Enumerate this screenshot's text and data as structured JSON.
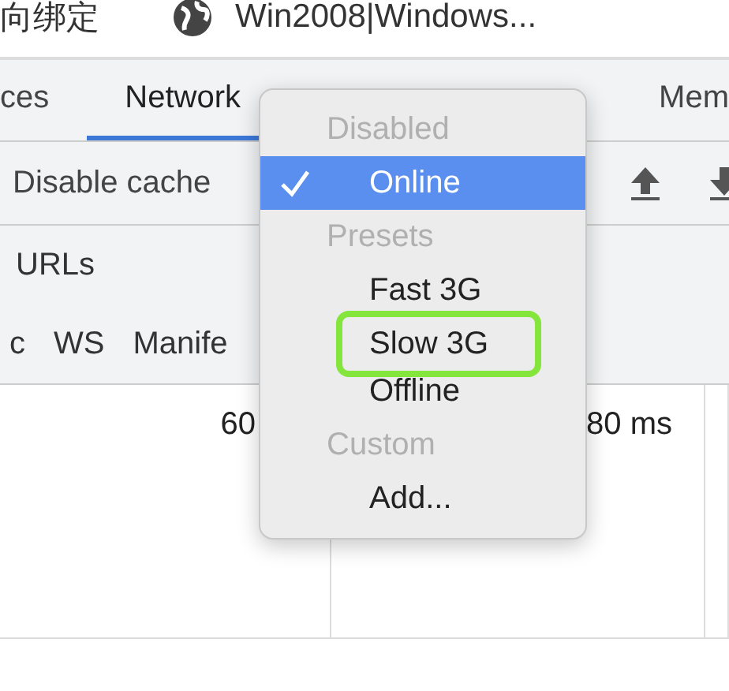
{
  "browser_tabs": [
    {
      "title": "向绑定",
      "icon": false
    },
    {
      "title": "Win2008|Windows...",
      "icon": true
    }
  ],
  "devtools_tabs": [
    {
      "label": "ces",
      "selected": false
    },
    {
      "label": "Network",
      "selected": true
    },
    {
      "label": "Mem",
      "selected": false
    }
  ],
  "toolbar": {
    "disable_cache": "Disable cache"
  },
  "filter": {
    "data_urls": "URLs",
    "types": [
      "c",
      "WS",
      "Manife"
    ]
  },
  "table": {
    "row": {
      "column_1": "60",
      "column_2": "80 ms"
    }
  },
  "throttle_menu": [
    {
      "kind": "header",
      "label": "Disabled"
    },
    {
      "kind": "option",
      "label": "Online",
      "selected": true,
      "highlighted": false
    },
    {
      "kind": "header",
      "label": "Presets"
    },
    {
      "kind": "option",
      "label": "Fast 3G",
      "selected": false,
      "highlighted": false
    },
    {
      "kind": "option",
      "label": "Slow 3G",
      "selected": false,
      "highlighted": true
    },
    {
      "kind": "option",
      "label": "Offline",
      "selected": false,
      "highlighted": false
    },
    {
      "kind": "header",
      "label": "Custom"
    },
    {
      "kind": "option",
      "label": "Add...",
      "selected": false,
      "highlighted": false
    }
  ]
}
